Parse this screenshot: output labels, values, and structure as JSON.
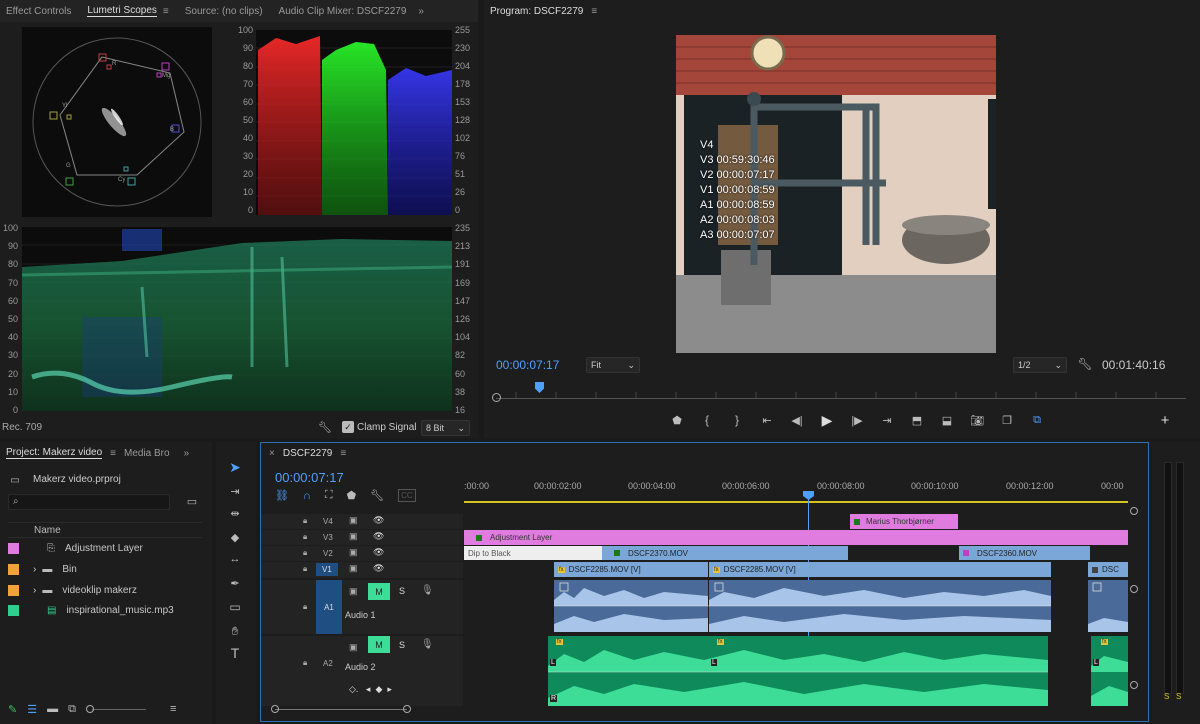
{
  "scopes_panel": {
    "tabs": [
      "Effect Controls",
      "Lumetri Scopes",
      "Source: (no clips)",
      "Audio Clip Mixer: DSCF2279"
    ],
    "more": "»",
    "parade_ticks_left": [
      "100",
      "90",
      "80",
      "70",
      "60",
      "50",
      "40",
      "30",
      "20",
      "10",
      "0"
    ],
    "parade_ticks_right": [
      "255",
      "230",
      "204",
      "178",
      "153",
      "128",
      "102",
      "76",
      "51",
      "26",
      "0"
    ],
    "wave_ticks_left": [
      "100",
      "90",
      "80",
      "70",
      "60",
      "50",
      "40",
      "30",
      "20",
      "10",
      "0"
    ],
    "wave_ticks_right": [
      "235",
      "213",
      "191",
      "169",
      "147",
      "126",
      "104",
      "82",
      "60",
      "38",
      "16"
    ],
    "vector_labels": [
      "R",
      "Mg",
      "B",
      "Cy",
      "G",
      "Yl"
    ],
    "footer": {
      "colorspace": "Rec. 709",
      "clamp_label": "Clamp Signal",
      "bit_depth": "8 Bit"
    }
  },
  "program": {
    "title": "Program: DSCF2279",
    "timecode": "00:00:07:17",
    "zoom": "Fit",
    "resolution": "1/2",
    "duration": "00:01:40:16",
    "overlay": [
      "V4",
      "V3 00:59:30:46",
      "V2 00:00:07:17",
      "V1 00:00:08:59",
      "A1 00:00:08:59",
      "A2 00:00:08:03",
      "A3 00:00:07:07"
    ]
  },
  "project": {
    "tab": "Project: Makerz video",
    "tab2": "Media Bro",
    "file": "Makerz video.prproj",
    "search_placeholder": "",
    "header": "Name",
    "items": [
      {
        "name": "Adjustment Layer",
        "color": "#e07ce0"
      },
      {
        "name": "Bin",
        "color": "#f2a23a"
      },
      {
        "name": "videoklip makerz",
        "color": "#f2a23a"
      },
      {
        "name": "inspirational_music.mp3",
        "color": "#2ecf8e"
      }
    ]
  },
  "timeline": {
    "tab": "DSCF2279",
    "timecode": "00:00:07:17",
    "ruler": [
      ":00:00",
      "00:00:02:00",
      "00:00:04:00",
      "00:00:06:00",
      "00:00:08:00",
      "00:00:10:00",
      "00:00:12:00",
      "00:00"
    ],
    "tracks": {
      "v4": "V4",
      "v3": "V3",
      "v2": "V2",
      "v1": "V1",
      "a1": "A1",
      "a2": "A2",
      "audio1": "Audio 1",
      "audio2": "Audio 2",
      "m": "M",
      "s": "S"
    },
    "clips": {
      "marius": "Marius Thorbjørner",
      "adjustment": "Adjustment Layer",
      "dip": "Dip to Black",
      "dscf2370": "DSCF2370.MOV",
      "dscf2360": "DSCF2360.MOV",
      "dscf2285a": "DSCF2285.MOV [V]",
      "dscf2285b": "DSCF2285.MOV [V]",
      "dsc": "DSC",
      "fx": "fx",
      "l": "L",
      "r": "R"
    },
    "colors": {
      "video": "#7aa7d8",
      "pink": "#e07ce0",
      "audio": "#1ec48a",
      "accent": "#4ea0ff"
    }
  },
  "meter": {
    "s1": "S",
    "s2": "S"
  }
}
